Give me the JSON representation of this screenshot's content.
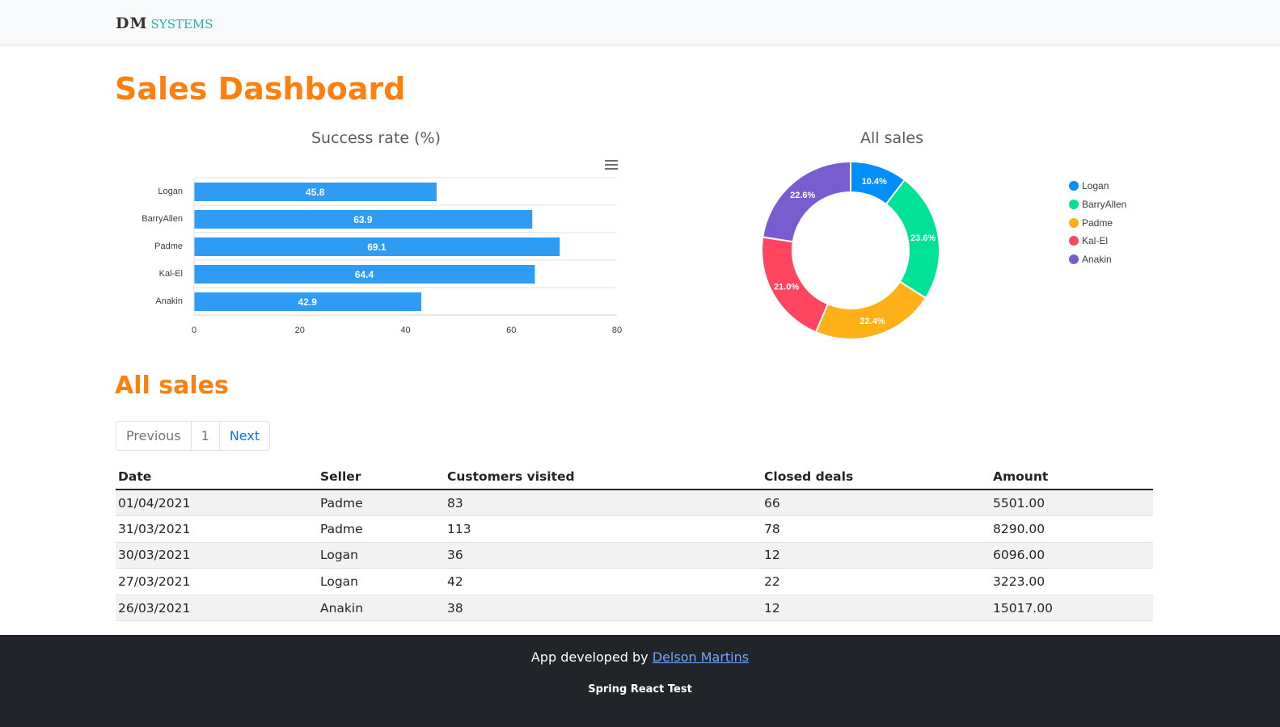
{
  "navbar": {
    "brand_main": "DM",
    "brand_sub": "SYSTEMS"
  },
  "page_title": "Sales Dashboard",
  "charts": {
    "bar_title": "Success rate (%)",
    "donut_title": "All sales"
  },
  "colors": {
    "accent": "#ff7f0e",
    "bar": "#2e9bf5",
    "series": [
      "#008ffb",
      "#00e396",
      "#feb019",
      "#ff4560",
      "#775dd0"
    ]
  },
  "chart_data": [
    {
      "type": "bar",
      "orientation": "horizontal",
      "title": "Success rate (%)",
      "categories": [
        "Logan",
        "BarryAllen",
        "Padme",
        "Kal-El",
        "Anakin"
      ],
      "values": [
        45.8,
        63.9,
        69.1,
        64.4,
        42.9
      ],
      "xticks": [
        0,
        20,
        40,
        60,
        80
      ],
      "xlim": [
        0,
        80
      ],
      "grid": true
    },
    {
      "type": "pie",
      "variant": "donut",
      "title": "All sales",
      "labels": [
        "Logan",
        "BarryAllen",
        "Padme",
        "Kal-El",
        "Anakin"
      ],
      "values": [
        10.4,
        23.6,
        22.4,
        21.0,
        22.6
      ],
      "value_labels": [
        "10.4%",
        "23.6%",
        "22.4%",
        "21.0%",
        "22.6%"
      ],
      "legend": "right"
    }
  ],
  "section_title": "All sales",
  "pagination": {
    "previous": "Previous",
    "current": "1",
    "next": "Next"
  },
  "table": {
    "headers": [
      "Date",
      "Seller",
      "Customers visited",
      "Closed deals",
      "Amount"
    ],
    "rows": [
      [
        "01/04/2021",
        "Padme",
        "83",
        "66",
        "5501.00"
      ],
      [
        "31/03/2021",
        "Padme",
        "113",
        "78",
        "8290.00"
      ],
      [
        "30/03/2021",
        "Logan",
        "36",
        "12",
        "6096.00"
      ],
      [
        "27/03/2021",
        "Logan",
        "42",
        "22",
        "3223.00"
      ],
      [
        "26/03/2021",
        "Anakin",
        "38",
        "12",
        "15017.00"
      ]
    ]
  },
  "footer": {
    "prefix": "App developed by",
    "author": "Delson Martins",
    "subtitle": "Spring React Test"
  }
}
